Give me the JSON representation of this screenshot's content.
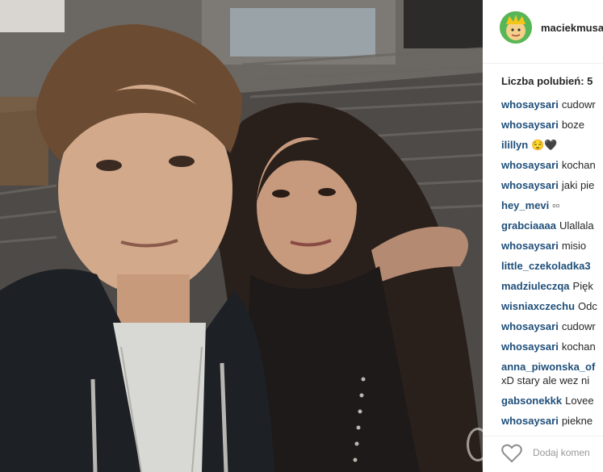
{
  "post": {
    "username": "maciekmusa",
    "likes_label": "Liczba polubień: 5",
    "add_comment_placeholder": "Dodaj komen"
  },
  "comments": [
    {
      "user": "whosaysari",
      "text": "cudowr"
    },
    {
      "user": "whosaysari",
      "text": "boze"
    },
    {
      "user": "ilillyn",
      "text": "😌🖤"
    },
    {
      "user": "whosaysari",
      "text": "kochan"
    },
    {
      "user": "whosaysari",
      "text": "jaki pie"
    },
    {
      "user": "hey_mevi",
      "text": "▫▫"
    },
    {
      "user": "grabciaaaa",
      "text": "Ulallala"
    },
    {
      "user": "whosaysari",
      "text": "misio"
    },
    {
      "user": "little_czekoladka3",
      "text": ""
    },
    {
      "user": "madziuleczqa",
      "text": "Pięk"
    },
    {
      "user": "wisniaxczechu",
      "text": "Odc"
    },
    {
      "user": "whosaysari",
      "text": "cudowr"
    },
    {
      "user": "whosaysari",
      "text": "kochan"
    },
    {
      "user": "anna_piwonska_of",
      "text": "xD stary ale wez ni"
    },
    {
      "user": "gabsonekkk",
      "text": "Lovee"
    },
    {
      "user": "whosaysari",
      "text": "piekne"
    }
  ],
  "colors": {
    "username": "#262626",
    "comment_user": "#1f4f7a",
    "divider": "#efefef"
  },
  "icons": {
    "heart": "heart-icon",
    "avatar": "avatar"
  }
}
